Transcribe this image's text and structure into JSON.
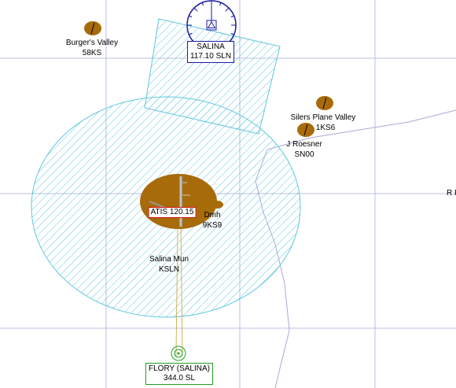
{
  "colors": {
    "grid": "#b8bfe0",
    "airspace": "#5fc6df",
    "airport": "#a86b0a",
    "vor": "#1a1aa0",
    "ndb": "#20a020",
    "route": "#d2b15a",
    "boundary": "#a9a9d6",
    "atis_border": "#d01010"
  },
  "vor": {
    "name": "SALINA",
    "frequency": "117.10 SLN",
    "icon": "vor-compass-rose-icon"
  },
  "ndb": {
    "name": "FLORY (SALINA)",
    "frequency": "344.0 SL",
    "icon": "ndb-icon"
  },
  "atis": {
    "label": "ATIS 120.15"
  },
  "airports": [
    {
      "name": "Burger's Valley",
      "ident": "58KS",
      "icon": "airport-grass-strip-icon"
    },
    {
      "name": "Silers Plane Valley",
      "ident": "1KS6",
      "icon": "airport-grass-strip-icon"
    },
    {
      "name": "J Roesner",
      "ident": "SN00",
      "icon": "airport-grass-strip-icon"
    },
    {
      "name": "Salina Mun",
      "ident": "KSLN",
      "icon": "airport-towered-icon"
    },
    {
      "name": "Dmh",
      "ident": "9KS9",
      "icon": "airport-icon"
    }
  ],
  "edge_text": "R F"
}
